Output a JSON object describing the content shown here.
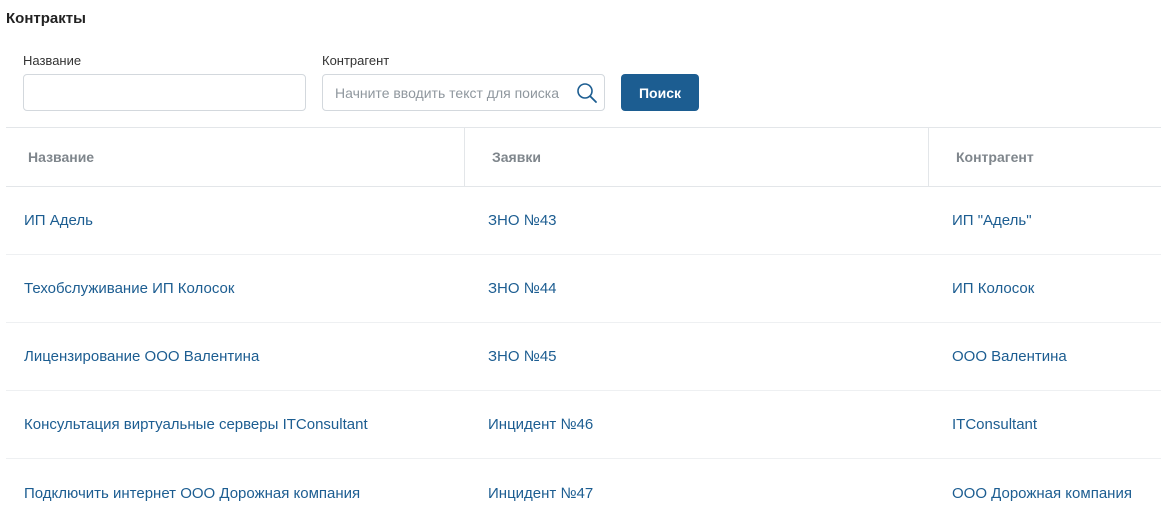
{
  "page": {
    "title": "Контракты"
  },
  "filters": {
    "name": {
      "label": "Название",
      "value": "",
      "placeholder": ""
    },
    "contractor": {
      "label": "Контрагент",
      "value": "",
      "placeholder": "Начните вводить текст для поиска"
    },
    "search_button": "Поиск"
  },
  "table": {
    "columns": [
      "Название",
      "Заявки",
      "Контрагент"
    ],
    "rows": [
      [
        "ИП Адель",
        "ЗНО №43",
        "ИП \"Адель\""
      ],
      [
        "Техобслуживание ИП Колосок",
        "ЗНО №44",
        "ИП Колосок"
      ],
      [
        "Лицензирование ООО Валентина",
        "ЗНО №45",
        "ООО Валентина"
      ],
      [
        "Консультация виртуальные серверы ITConsultant",
        "Инцидент №46",
        "ITConsultant"
      ],
      [
        "Подключить интернет ООО Дорожная компания",
        "Инцидент №47",
        "ООО Дорожная компания"
      ]
    ]
  },
  "colors": {
    "accent": "#1c5d91",
    "link": "#1c5d91",
    "header_text": "#7f868c",
    "border": "#e3e6e9"
  },
  "icons": {
    "search": "search-icon"
  }
}
